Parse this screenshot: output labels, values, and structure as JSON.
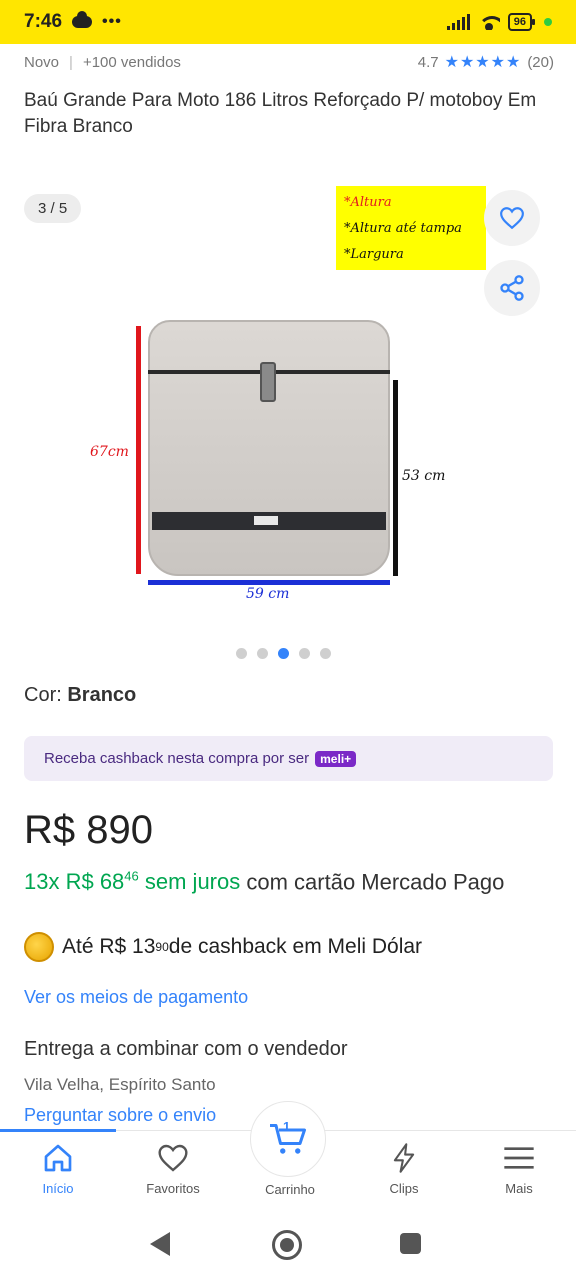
{
  "status": {
    "time": "7:46",
    "dots": "•••",
    "battery": "96"
  },
  "meta": {
    "condition": "Novo",
    "separator": "|",
    "sold": "+100 vendidos",
    "rating": "4.7",
    "stars": "★★★★★",
    "reviews": "(20)"
  },
  "title": "Baú Grande Para Moto 186 Litros Reforçado P/ motoboy Em Fibra Branco",
  "gallery": {
    "counter": "3 / 5",
    "note_lines": [
      "*Altura",
      "*Altura até tampa",
      "*Largura"
    ],
    "dim_height": "67cm",
    "dim_depth": "53 cm",
    "dim_width": "59 cm",
    "total_images": 5,
    "active_index": 3
  },
  "color": {
    "label": "Cor: ",
    "value": "Branco"
  },
  "cashback_banner": {
    "text": "Receba cashback nesta compra por ser",
    "badge": "meli+"
  },
  "price": "R$ 890",
  "installments": {
    "count": "13x R$ 68",
    "cents": "46",
    "interest": " sem juros",
    "rest": " com cartão Mercado Pago"
  },
  "meli_dolar": {
    "prefix": "Até R$ 13",
    "cents": "90",
    "suffix": " de cashback em Meli Dólar"
  },
  "payment_link": "Ver os meios de pagamento",
  "delivery": "Entrega a combinar com o vendedor",
  "location": "Vila Velha, Espírito Santo",
  "ask_link": "Perguntar sobre o envio",
  "bottom_nav": {
    "home": "Início",
    "favorites": "Favoritos",
    "cart": "Carrinho",
    "cart_count": "1",
    "clips": "Clips",
    "more": "Mais"
  },
  "colors": {
    "accent": "#3483FA",
    "brand_yellow": "#FFE600",
    "green": "#00A650"
  }
}
